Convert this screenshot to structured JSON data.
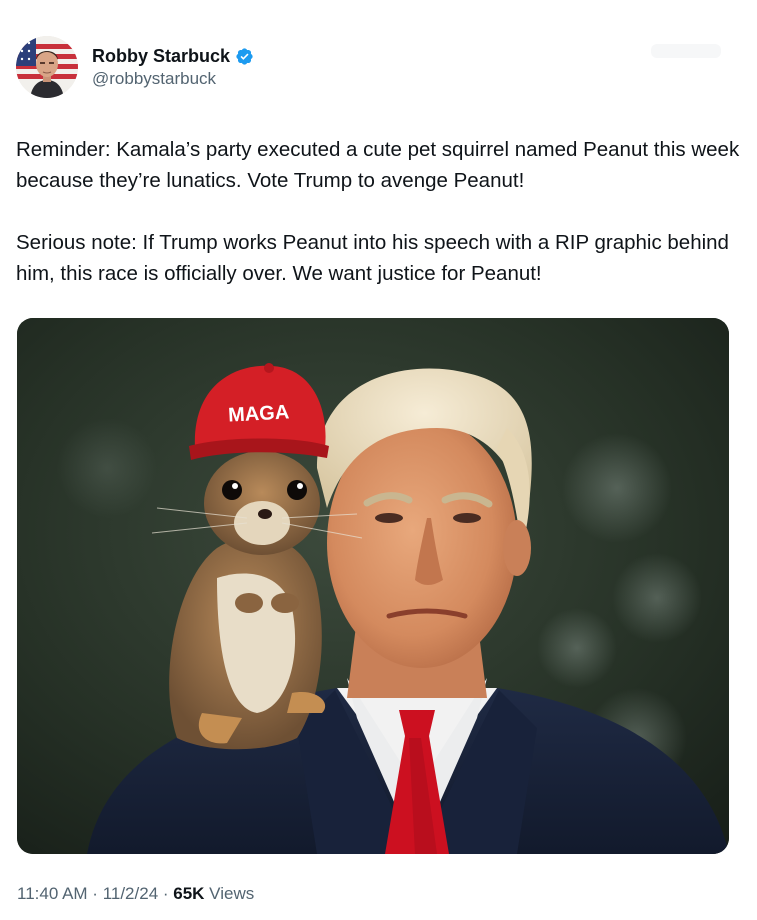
{
  "user": {
    "display_name": "Robby Starbuck",
    "handle": "@robbystarbuck",
    "verified": true,
    "avatar_icon": "profile-photo",
    "verified_icon": "verified-badge-icon"
  },
  "post": {
    "paragraphs": [
      "Reminder: Kamala’s party executed a cute pet squirrel named Peanut this week because they’re lunatics. Vote Trump to avenge Peanut!",
      "Serious note: If Trump works Peanut into his speech with a RIP graphic behind him, this race is officially over. We want justice for Peanut!"
    ],
    "image": {
      "cap_text": "MAGA"
    }
  },
  "meta": {
    "time": "11:40 AM",
    "separator": " · ",
    "date": "11/2/24",
    "views_count": "65K",
    "views_label": " Views"
  },
  "colors": {
    "verified": "#1d9bf0",
    "secondary_text": "#536471",
    "primary_text": "#0f1419",
    "cap_red": "#d41f26",
    "tie_red": "#cc1020"
  }
}
